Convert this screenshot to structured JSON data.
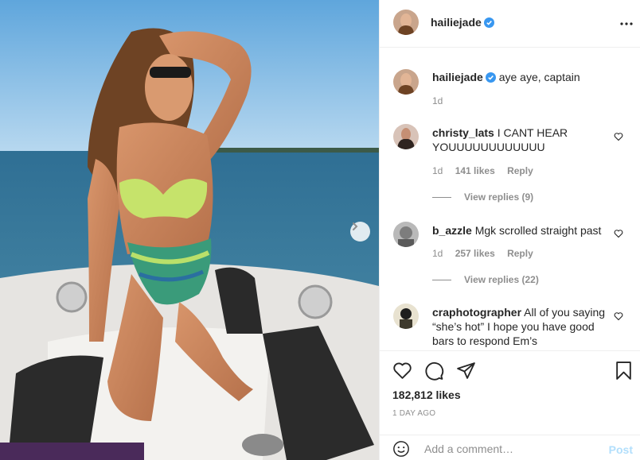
{
  "post": {
    "author": "hailiejade",
    "caption": "aye aye, captain",
    "caption_age": "1d",
    "likes": "182,812 likes",
    "posted": "1 DAY AGO"
  },
  "comments": [
    {
      "user": "christy_lats",
      "text": "I CANT HEAR YOUUUUUUUUUUUU",
      "age": "1d",
      "likes": "141 likes",
      "reply": "Reply",
      "view_replies": "View replies (9)"
    },
    {
      "user": "b_azzle",
      "text": "Mgk scrolled straight past",
      "age": "1d",
      "likes": "257 likes",
      "reply": "Reply",
      "view_replies": "View replies (22)"
    },
    {
      "user": "craphotographer",
      "text": "All of you saying “she’s hot” I hope you have good bars to respond Em’s"
    }
  ],
  "composer": {
    "placeholder": "Add a comment…",
    "post_label": "Post"
  },
  "colors": {
    "verified": "#3897f0",
    "post_button": "#b2dffc",
    "muted": "#8e8e8e"
  },
  "icons": [
    "more-icon",
    "heart-icon",
    "comment-icon",
    "share-icon",
    "bookmark-icon",
    "emoji-icon",
    "chevron-right-icon",
    "verified-icon"
  ]
}
